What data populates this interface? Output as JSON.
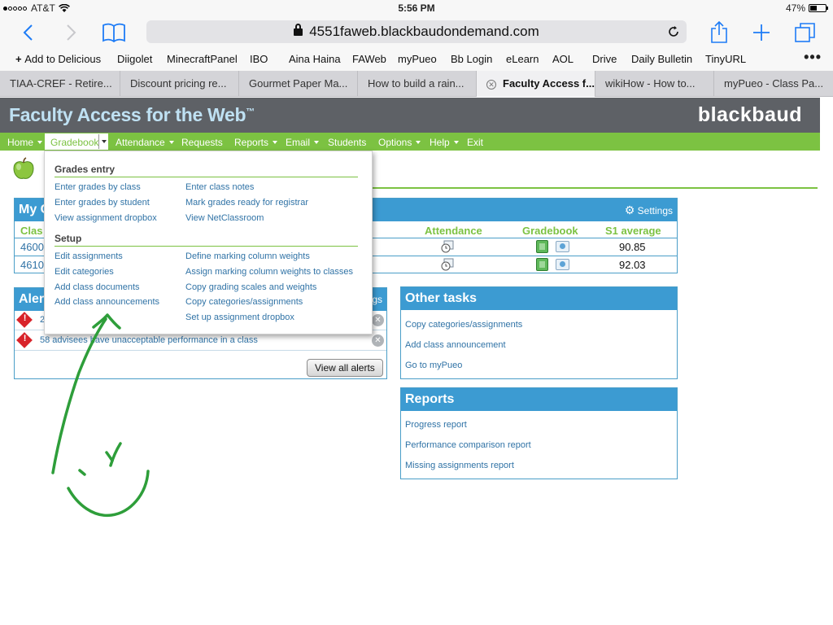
{
  "status_bar": {
    "carrier": "AT&T",
    "time": "5:56 PM",
    "battery": "47%",
    "battery_level": 0.47
  },
  "browser": {
    "url": "4551faweb.blackbaudondemand.com",
    "bookmarks": [
      "Add to Delicious",
      "Diigolet",
      "MinecraftPanel",
      "IBO",
      "Aina Haina",
      "FAWeb",
      "myPueo",
      "Bb Login",
      "eLearn",
      "AOL",
      "Drive",
      "Daily Bulletin",
      "TinyURL"
    ],
    "tabs": [
      {
        "label": "TIAA-CREF - Retire..."
      },
      {
        "label": "Discount pricing re..."
      },
      {
        "label": "Gourmet Paper Ma..."
      },
      {
        "label": "How to build a rain..."
      },
      {
        "label": "Faculty Access f...",
        "active": true
      },
      {
        "label": "wikiHow - How to..."
      },
      {
        "label": "myPueo - Class Pa..."
      }
    ]
  },
  "site": {
    "title": "Faculty Access for the Web",
    "tm": "™",
    "brand": "blackbaud"
  },
  "nav": {
    "items": [
      "Home",
      "Gradebook",
      "Attendance",
      "Requests",
      "Reports",
      "Email",
      "Students",
      "Options",
      "Help",
      "Exit"
    ]
  },
  "dropdown": {
    "grades_entry": {
      "title": "Grades entry",
      "left": [
        "Enter grades by class",
        "Enter grades by student",
        "View assignment dropbox"
      ],
      "right": [
        "Enter class notes",
        "Mark grades ready for registrar",
        "View NetClassroom"
      ]
    },
    "setup": {
      "title": "Setup",
      "left": [
        "Edit assignments",
        "Edit categories",
        "Add class documents",
        "Add class announcements"
      ],
      "right": [
        "Define marking column weights",
        "Assign marking column weights to classes",
        "Copy grading scales and weights",
        "Copy categories/assignments",
        "Set up assignment dropbox"
      ]
    }
  },
  "classes_panel": {
    "title": "My C",
    "settings": "Settings",
    "columns": {
      "class": "Clas",
      "attendance": "Attendance",
      "gradebook": "Gradebook",
      "average": "S1 average"
    },
    "rows": [
      {
        "id": "4600",
        "average": "90.85"
      },
      {
        "id": "4610",
        "average": "92.03"
      }
    ]
  },
  "alerts_panel": {
    "title": "Aler",
    "settings_fragment": "gs",
    "rows": [
      "2",
      "58 advisees have unacceptable performance in a class"
    ],
    "button": "View all alerts"
  },
  "other_tasks": {
    "title": "Other tasks",
    "links": [
      "Copy categories/assignments",
      "Add class announcement",
      "Go to myPueo"
    ]
  },
  "reports_panel": {
    "title": "Reports",
    "links": [
      "Progress report",
      "Performance comparison report",
      "Missing assignments report"
    ]
  },
  "colors": {
    "nav_green": "#7cc242",
    "header_gray": "#5e6166",
    "panel_blue": "#3c9bd2",
    "link_blue": "#3073a6",
    "ink_green": "#2e9e3a"
  }
}
